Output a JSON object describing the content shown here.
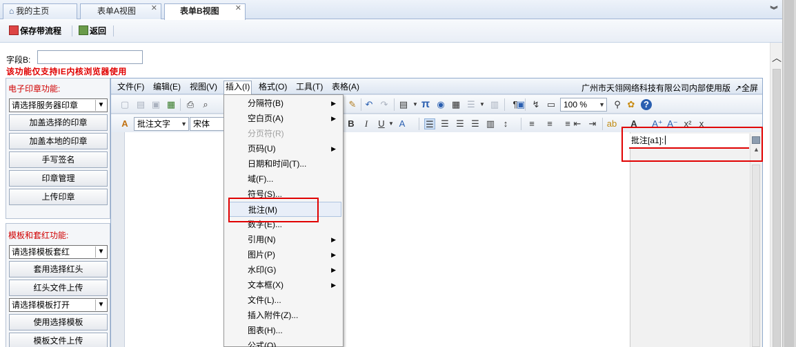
{
  "tabs": [
    {
      "label": "我的主页",
      "active": false,
      "closable": false
    },
    {
      "label": "表单A视图",
      "active": false,
      "closable": true
    },
    {
      "label": "表单B视图",
      "active": true,
      "closable": true
    }
  ],
  "actions": {
    "save": "保存带流程",
    "back": "返回"
  },
  "form": {
    "field_label": "字段B:",
    "field_value": "",
    "warning": "该功能仅支持IE内核浏览器使用"
  },
  "seal_panel": {
    "title": "电子印章功能:",
    "select": "请选择服务器印章",
    "buttons": [
      "加盖选择的印章",
      "加盖本地的印章",
      "手写签名",
      "印章管理",
      "上传印章"
    ]
  },
  "template_panel": {
    "title": "模板和套红功能:",
    "select1": "请选择模板套红",
    "btn1": "套用选择红头",
    "btn2": "红头文件上传",
    "select2": "请选择模板打开",
    "btn3": "使用选择模板",
    "btn4": "模板文件上传"
  },
  "menubar": {
    "items": [
      "文件(F)",
      "编辑(E)",
      "视图(V)",
      "插入(I)",
      "格式(O)",
      "工具(T)",
      "表格(A)"
    ],
    "company": "广州市天翎网络科技有限公司内部使用版",
    "fullscreen": "↗全屏"
  },
  "toolbar": {
    "zoom": "100 %",
    "style": "批注文字",
    "font": "宋体"
  },
  "insert_menu": [
    {
      "label": "分隔符(B)",
      "sub": true,
      "disabled": false
    },
    {
      "label": "空白页(A)",
      "sub": true,
      "disabled": false
    },
    {
      "label": "分页符(R)",
      "sub": false,
      "disabled": true
    },
    {
      "label": "页码(U)",
      "sub": true,
      "disabled": false
    },
    {
      "label": "日期和时间(T)...",
      "sub": false,
      "disabled": false
    },
    {
      "label": "域(F)...",
      "sub": false,
      "disabled": false
    },
    {
      "label": "符号(S)...",
      "sub": false,
      "disabled": false
    },
    {
      "label": "批注(M)",
      "sub": false,
      "disabled": false
    },
    {
      "label": "数字(E)...",
      "sub": false,
      "disabled": false
    },
    {
      "label": "引用(N)",
      "sub": true,
      "disabled": false
    },
    {
      "label": "图片(P)",
      "sub": true,
      "disabled": false
    },
    {
      "label": "水印(G)",
      "sub": true,
      "disabled": false
    },
    {
      "label": "文本框(X)",
      "sub": true,
      "disabled": false
    },
    {
      "label": "文件(L)...",
      "sub": false,
      "disabled": false
    },
    {
      "label": "插入附件(Z)...",
      "sub": false,
      "disabled": false
    },
    {
      "label": "图表(H)...",
      "sub": false,
      "disabled": false
    },
    {
      "label": "公式(Q)...",
      "sub": false,
      "disabled": false
    }
  ],
  "comment": {
    "text": "批注[a1]:"
  },
  "colors": {
    "accent_red": "#e00000",
    "menu_hover": "#e8eef8",
    "border_blue": "#8fa9cc"
  }
}
